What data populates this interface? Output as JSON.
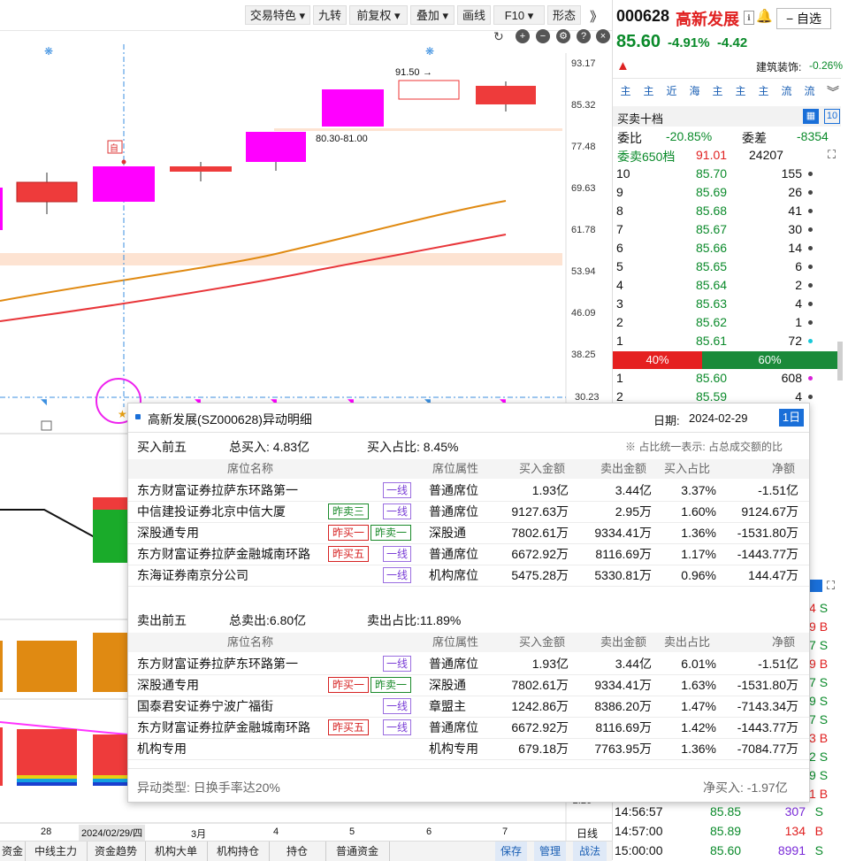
{
  "toolbar": {
    "trading_features": "交易特色",
    "jiuzhuan": "九转",
    "fq": "前复权",
    "overlay": "叠加",
    "draw_line": "画线",
    "f10": "F10",
    "shape": "形态",
    "more": "》"
  },
  "chart": {
    "y_labels": [
      "93.17",
      "85.32",
      "77.48",
      "69.63",
      "61.78",
      "53.94",
      "46.09",
      "38.25",
      "30.23"
    ],
    "annotation_high": "91.50",
    "annotation_range": "80.30-81.00",
    "self_marker": "自",
    "sub_y_label": "-2.26",
    "x_labels": [
      "28",
      "2024/02/29/四",
      "3月",
      "4",
      "5",
      "6",
      "7"
    ],
    "timeframe": "日线"
  },
  "bottom_bar": {
    "tabs": [
      "资金",
      "中线主力",
      "资金趋势",
      "机构大单",
      "机构持仓",
      "持仓",
      "普通资金"
    ],
    "right_buttons": [
      "保存",
      "管理",
      "战法"
    ]
  },
  "stock": {
    "code": "000628",
    "name": "高新发展",
    "price": "85.60",
    "change_pct": "-4.91%",
    "change": "-4.42",
    "add_watch": "自选",
    "industry_label": "建筑装饰:",
    "industry_change": "-0.26%",
    "tags": [
      "主",
      "主",
      "近",
      "海",
      "主",
      "主",
      "主",
      "流",
      "流"
    ],
    "orderbook_title": "买卖十档",
    "level_count": "10",
    "wei_bi_label": "委比",
    "wei_bi": "-20.85%",
    "wei_cha_label": "委差",
    "wei_cha": "-8354",
    "sell650_label": "委卖650档",
    "sell650_price": "91.01",
    "sell650_volume": "24207",
    "asks": [
      {
        "level": "10",
        "price": "85.70",
        "vol": "155"
      },
      {
        "level": "9",
        "price": "85.69",
        "vol": "26"
      },
      {
        "level": "8",
        "price": "85.68",
        "vol": "41"
      },
      {
        "level": "7",
        "price": "85.67",
        "vol": "30"
      },
      {
        "level": "6",
        "price": "85.66",
        "vol": "14"
      },
      {
        "level": "5",
        "price": "85.65",
        "vol": "6"
      },
      {
        "level": "4",
        "price": "85.64",
        "vol": "2"
      },
      {
        "level": "3",
        "price": "85.63",
        "vol": "4"
      },
      {
        "level": "2",
        "price": "85.62",
        "vol": "1"
      },
      {
        "level": "1",
        "price": "85.61",
        "vol": "72"
      }
    ],
    "sell_ratio": "40%",
    "buy_ratio": "60%",
    "bids": [
      {
        "level": "1",
        "price": "85.60",
        "vol": "608"
      },
      {
        "level": "2",
        "price": "85.59",
        "vol": "4"
      }
    ],
    "tick_tail": [
      {
        "v": "4",
        "s": "S"
      },
      {
        "v": "9",
        "s": "B"
      },
      {
        "v": "7",
        "s": "S"
      },
      {
        "v": "9",
        "s": "B"
      },
      {
        "v": "7",
        "s": "S"
      },
      {
        "v": "9",
        "s": "S"
      },
      {
        "v": "7",
        "s": "S"
      },
      {
        "v": "3",
        "s": "B"
      },
      {
        "v": "2",
        "s": "S"
      },
      {
        "v": "9",
        "s": "S"
      },
      {
        "v": "1",
        "s": "B"
      }
    ],
    "ticks": [
      {
        "time": "14:56:57",
        "price": "85.85",
        "vol": "307",
        "side": "S"
      },
      {
        "time": "14:57:00",
        "price": "85.89",
        "vol": "134",
        "side": "B"
      },
      {
        "time": "15:00:00",
        "price": "85.60",
        "vol": "8991",
        "side": "S"
      }
    ]
  },
  "popup": {
    "title": "高新发展(SZ000628)异动明细",
    "date_label": "日期:",
    "date": "2024-02-29",
    "period": "1日",
    "buy_section": "买入前五",
    "total_buy": "总买入: 4.83亿",
    "buy_ratio": "买入占比: 8.45%",
    "note": "※ 占比统一表示: 占总成交额的比",
    "sell_section": "卖出前五",
    "total_sell": "总卖出:6.80亿",
    "sell_ratio": "卖出占比:11.89%",
    "headers": [
      "席位名称",
      "席位属性",
      "买入金额",
      "卖出金额",
      "买入占比",
      "净额"
    ],
    "sell_headers": [
      "席位名称",
      "席位属性",
      "买入金额",
      "卖出金额",
      "卖出占比",
      "净额"
    ],
    "buy_rows": [
      {
        "name": "东方财富证券拉萨东环路第一",
        "badges": [
          {
            "t": "一线",
            "c": "purple"
          }
        ],
        "attr": "普通席位",
        "buy": "1.93亿",
        "sell": "3.44亿",
        "ratio": "3.37%",
        "net": "-1.51亿"
      },
      {
        "name": "中信建投证券北京中信大厦",
        "badges": [
          {
            "t": "昨卖三",
            "c": "green"
          },
          {
            "t": "一线",
            "c": "purple"
          }
        ],
        "attr": "普通席位",
        "buy": "9127.63万",
        "sell": "2.95万",
        "ratio": "1.60%",
        "net": "9124.67万"
      },
      {
        "name": "深股通专用",
        "badges": [
          {
            "t": "昨买一",
            "c": "red"
          },
          {
            "t": "昨卖一",
            "c": "green"
          }
        ],
        "attr": "深股通",
        "buy": "7802.61万",
        "sell": "9334.41万",
        "ratio": "1.36%",
        "net": "-1531.80万"
      },
      {
        "name": "东方财富证券拉萨金融城南环路",
        "badges": [
          {
            "t": "昨买五",
            "c": "red"
          },
          {
            "t": "一线",
            "c": "purple"
          }
        ],
        "attr": "普通席位",
        "buy": "6672.92万",
        "sell": "8116.69万",
        "ratio": "1.17%",
        "net": "-1443.77万"
      },
      {
        "name": "东海证券南京分公司",
        "badges": [
          {
            "t": "一线",
            "c": "purple"
          }
        ],
        "attr": "机构席位",
        "buy": "5475.28万",
        "sell": "5330.81万",
        "ratio": "0.96%",
        "net": "144.47万"
      }
    ],
    "sell_rows": [
      {
        "name": "东方财富证券拉萨东环路第一",
        "badges": [
          {
            "t": "一线",
            "c": "purple"
          }
        ],
        "attr": "普通席位",
        "buy": "1.93亿",
        "sell": "3.44亿",
        "ratio": "6.01%",
        "net": "-1.51亿"
      },
      {
        "name": "深股通专用",
        "badges": [
          {
            "t": "昨买一",
            "c": "red"
          },
          {
            "t": "昨卖一",
            "c": "green"
          }
        ],
        "attr": "深股通",
        "buy": "7802.61万",
        "sell": "9334.41万",
        "ratio": "1.63%",
        "net": "-1531.80万"
      },
      {
        "name": "国泰君安证券宁波广福街",
        "badges": [
          {
            "t": "一线",
            "c": "purple"
          }
        ],
        "attr": "章盟主",
        "buy": "1242.86万",
        "sell": "8386.20万",
        "ratio": "1.47%",
        "net": "-7143.34万"
      },
      {
        "name": "东方财富证券拉萨金融城南环路",
        "badges": [
          {
            "t": "昨买五",
            "c": "red"
          },
          {
            "t": "一线",
            "c": "purple"
          }
        ],
        "attr": "普通席位",
        "buy": "6672.92万",
        "sell": "8116.69万",
        "ratio": "1.42%",
        "net": "-1443.77万"
      },
      {
        "name": "机构专用",
        "badges": [],
        "attr": "机构专用",
        "buy": "679.18万",
        "sell": "7763.95万",
        "ratio": "1.36%",
        "net": "-7084.77万"
      }
    ],
    "anomaly_type": "异动类型: 日换手率达20%",
    "net_buy": "净买入: -1.97亿"
  }
}
